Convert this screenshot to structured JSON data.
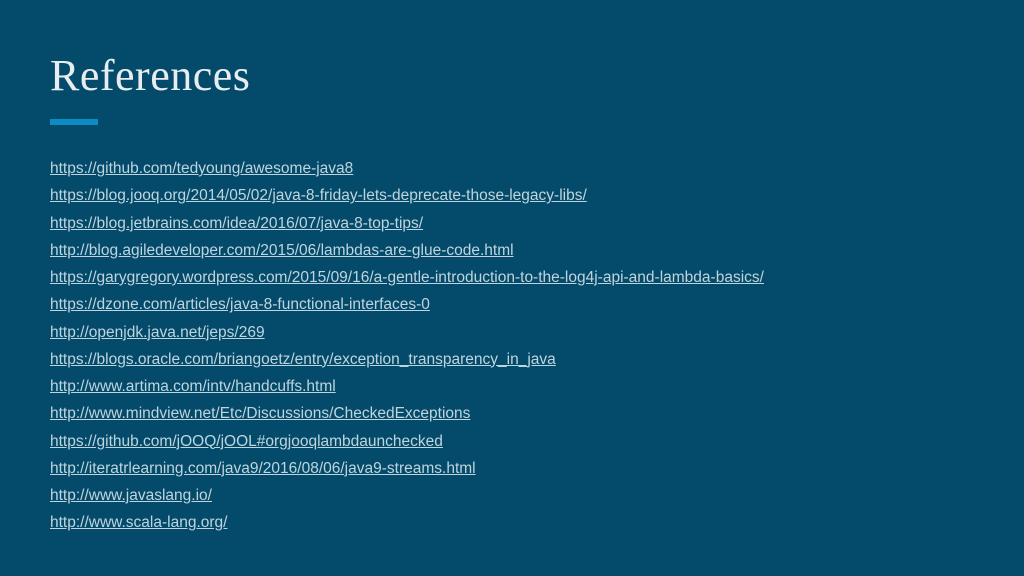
{
  "title": "References",
  "references": [
    "https://github.com/tedyoung/awesome-java8",
    "https://blog.jooq.org/2014/05/02/java-8-friday-lets-deprecate-those-legacy-libs/",
    "https://blog.jetbrains.com/idea/2016/07/java-8-top-tips/",
    "http://blog.agiledeveloper.com/2015/06/lambdas-are-glue-code.html",
    "https://garygregory.wordpress.com/2015/09/16/a-gentle-introduction-to-the-log4j-api-and-lambda-basics/",
    "https://dzone.com/articles/java-8-functional-interfaces-0",
    "http://openjdk.java.net/jeps/269",
    "https://blogs.oracle.com/briangoetz/entry/exception_transparency_in_java",
    "http://www.artima.com/intv/handcuffs.html",
    "http://www.mindview.net/Etc/Discussions/CheckedExceptions",
    "https://github.com/jOOQ/jOOL#orgjooqlambdaunchecked",
    "http://iteratrlearning.com/java9/2016/08/06/java9-streams.html",
    "http://www.javaslang.io/",
    "http://www.scala-lang.org/"
  ]
}
